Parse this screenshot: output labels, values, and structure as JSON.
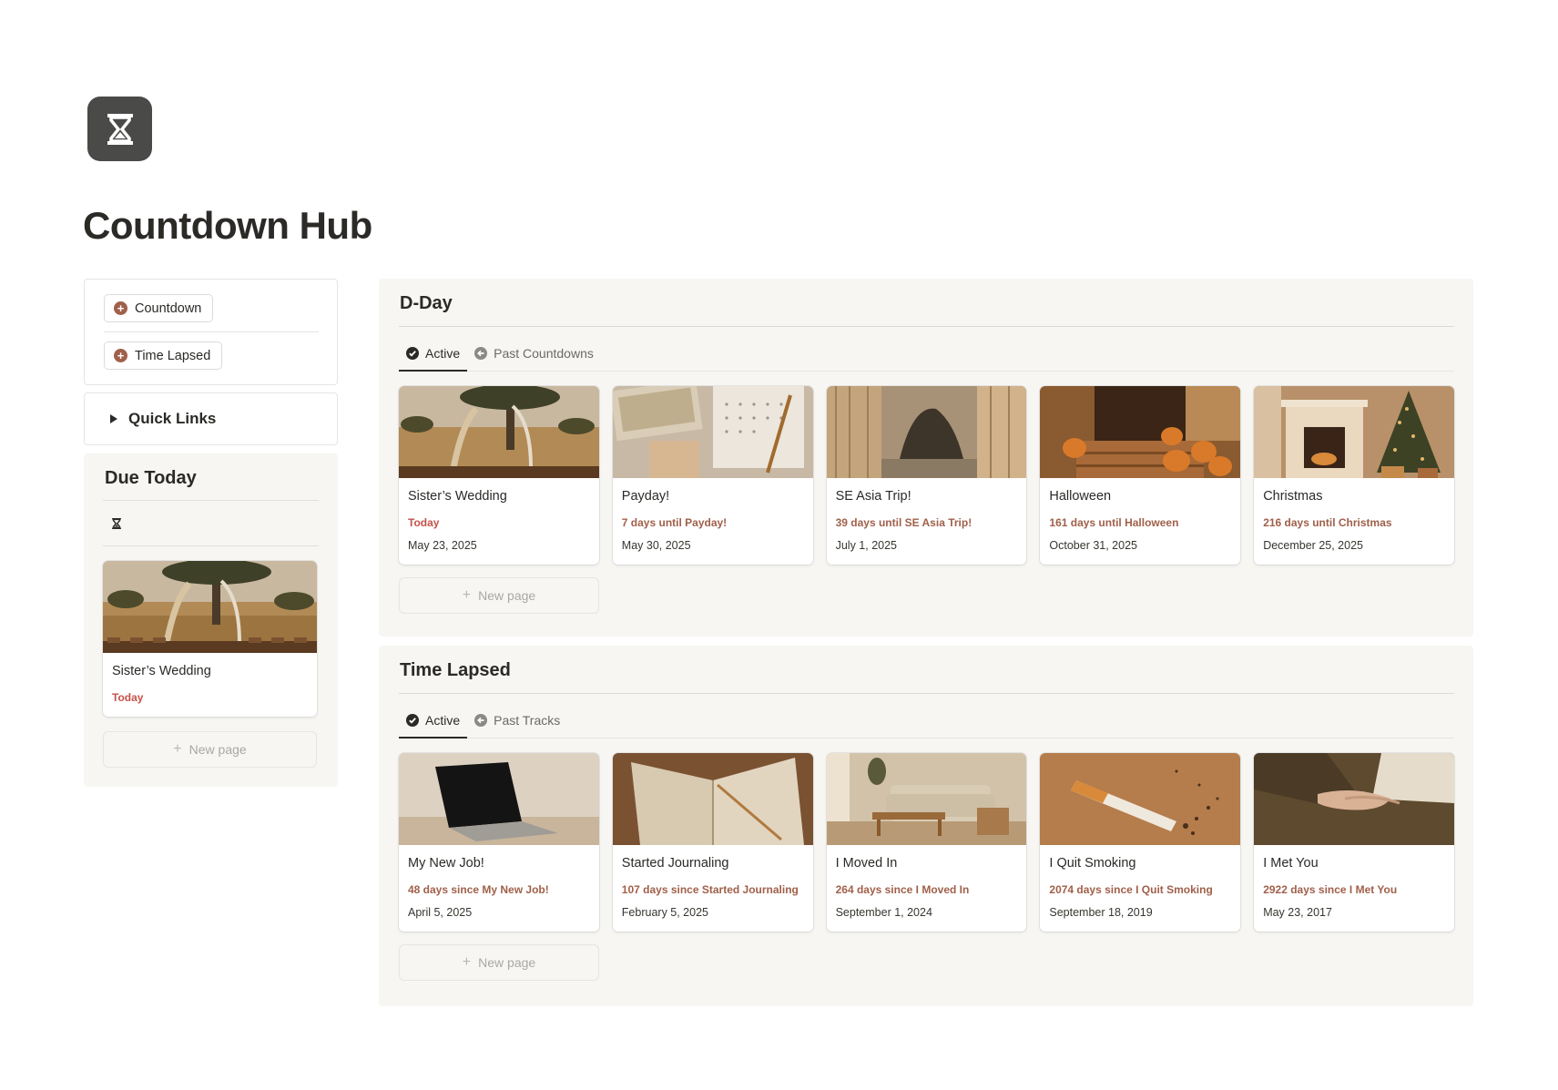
{
  "page": {
    "title": "Countdown Hub",
    "icon": "hourglass-icon"
  },
  "sidebar": {
    "buttons": [
      {
        "label": "Countdown",
        "icon": "plus-circle-icon"
      },
      {
        "label": "Time Lapsed",
        "icon": "plus-circle-icon"
      }
    ],
    "quick_links": {
      "label": "Quick Links"
    },
    "due_today": {
      "title": "Due Today",
      "icon": "hourglass-icon",
      "card": {
        "title": "Sister’s Wedding",
        "status": "Today",
        "image": "wedding-photo"
      },
      "new_page": "New page"
    }
  },
  "d_day": {
    "title": "D-Day",
    "tabs": [
      {
        "label": "Active",
        "icon": "check-circle-icon",
        "active": true
      },
      {
        "label": "Past Countdowns",
        "icon": "arrow-left-circle-icon",
        "active": false
      }
    ],
    "cards": [
      {
        "title": "Sister’s Wedding",
        "status": "Today",
        "date": "May 23, 2025",
        "image": "wedding-photo"
      },
      {
        "title": "Payday!",
        "status": "7 days until Payday!",
        "date": "May 30, 2025",
        "image": "money-calendar-photo"
      },
      {
        "title": "SE Asia Trip!",
        "status": "39 days until SE Asia Trip!",
        "date": "July 1, 2025",
        "image": "island-window-photo"
      },
      {
        "title": "Halloween",
        "status": "161 days until Halloween",
        "date": "October 31, 2025",
        "image": "pumpkins-photo"
      },
      {
        "title": "Christmas",
        "status": "216 days until Christmas",
        "date": "December 25, 2025",
        "image": "christmas-tree-photo"
      }
    ],
    "new_page": "New page"
  },
  "time_lapsed": {
    "title": "Time Lapsed",
    "tabs": [
      {
        "label": "Active",
        "icon": "check-circle-icon",
        "active": true
      },
      {
        "label": "Past Tracks",
        "icon": "arrow-left-circle-icon",
        "active": false
      }
    ],
    "cards": [
      {
        "title": "My New Job!",
        "status": "48 days since My New Job!",
        "date": "April 5, 2025",
        "image": "laptop-photo"
      },
      {
        "title": "Started Journaling",
        "status": "107 days since Started Journaling",
        "date": "February 5, 2025",
        "image": "journal-photo"
      },
      {
        "title": "I Moved In",
        "status": "264 days since I Moved In",
        "date": "September 1, 2024",
        "image": "living-room-photo"
      },
      {
        "title": "I Quit Smoking",
        "status": "2074 days since I Quit Smoking",
        "date": "September 18, 2019",
        "image": "cigarette-photo"
      },
      {
        "title": "I Met You",
        "status": "2922 days since I Met You",
        "date": "May 23, 2017",
        "image": "holding-hands-photo"
      }
    ],
    "new_page": "New page"
  },
  "colors": {
    "accent": "#a0604a",
    "today": "#c4524a",
    "panel": "#f7f6f3",
    "text": "#37352f"
  }
}
